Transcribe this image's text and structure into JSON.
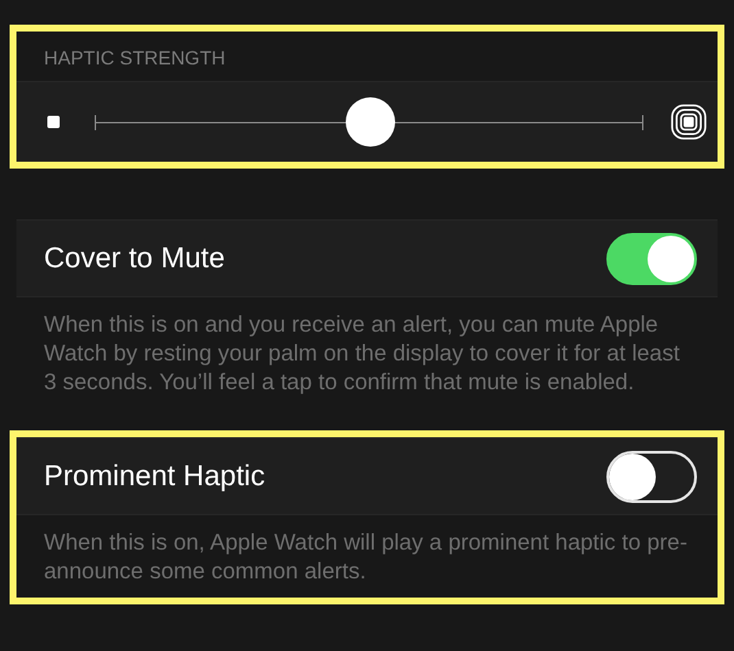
{
  "haptic_strength": {
    "header": "HAPTIC STRENGTH",
    "highlighted": true,
    "level": 0.5
  },
  "settings": [
    {
      "label": "Cover to Mute",
      "on": true,
      "highlighted": false,
      "description": "When this is on and you receive an alert, you can mute Apple Watch by resting your palm on the display to cover it for at least 3 seconds. You’ll feel a tap to confirm that mute is enabled."
    },
    {
      "label": "Prominent Haptic",
      "on": false,
      "highlighted": true,
      "description": "When this is on, Apple Watch will play a prominent haptic to pre-announce some common alerts."
    }
  ]
}
